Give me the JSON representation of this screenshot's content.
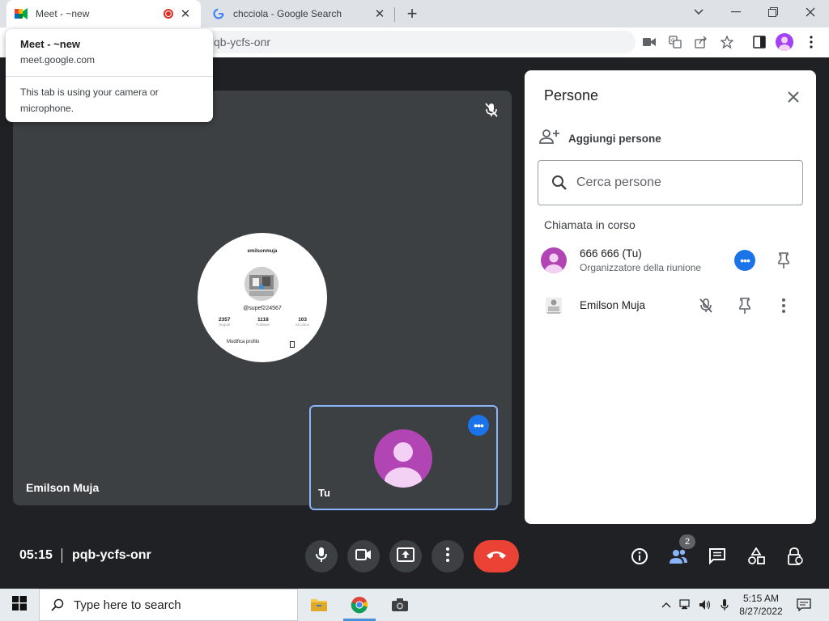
{
  "browser": {
    "tabs": [
      {
        "title": "Meet - ~new",
        "active": true
      },
      {
        "title": "chcciola - Google Search",
        "active": false
      }
    ],
    "url_visible": "qb-ycfs-onr",
    "popup": {
      "title": "Meet - ~new",
      "url": "meet.google.com",
      "message": "This tab is using your camera or microphone."
    }
  },
  "stage": {
    "presenter_name": "Emilson Muja",
    "shared_screen": {
      "username": "emilsonmuja",
      "handle": "@supef224567",
      "stats": [
        {
          "value": "2357",
          "label": "Seguiti"
        },
        {
          "value": "1118",
          "label": "Follower"
        },
        {
          "value": "103",
          "label": "Mi piace"
        }
      ],
      "edit_label": "Modifica profilo"
    },
    "self_tile_name": "Tu"
  },
  "panel": {
    "title": "Persone",
    "add_people": "Aggiungi persone",
    "search_placeholder": "Cerca persone",
    "section": "Chiamata in corso",
    "participants": [
      {
        "name": "666 666 (Tu)",
        "role": "Organizzatore della riunione"
      },
      {
        "name": "Emilson Muja",
        "role": ""
      }
    ]
  },
  "bottom": {
    "time": "05:15",
    "meeting_code": "pqb-ycfs-onr",
    "people_count": "2"
  },
  "taskbar": {
    "search_placeholder": "Type here to search",
    "time": "5:15 AM",
    "date": "8/27/2022"
  },
  "colors": {
    "meet_bg": "#202124",
    "tile_bg": "#3c4043",
    "accent_blue": "#1a73e8",
    "end_call_red": "#ea4335",
    "avatar_purple": "#b245b4"
  }
}
